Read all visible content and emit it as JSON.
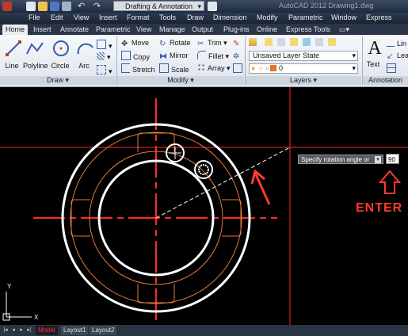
{
  "app": {
    "workspace": "Drafting & Annotation",
    "title": "AutoCAD 2012  Drawing1.dwg"
  },
  "menu": [
    "File",
    "Edit",
    "View",
    "Insert",
    "Format",
    "Tools",
    "Draw",
    "Dimension",
    "Modify",
    "Parametric",
    "Window",
    "Express"
  ],
  "tabs": [
    "Home",
    "Insert",
    "Annotate",
    "Parametric",
    "View",
    "Manage",
    "Output",
    "Plug-ins",
    "Online",
    "Express Tools"
  ],
  "ribbon": {
    "draw": {
      "title": "Draw",
      "line": "Line",
      "polyline": "Polyline",
      "circle": "Circle",
      "arc": "Arc"
    },
    "modify": {
      "title": "Modify",
      "move": "Move",
      "rotate": "Rotate",
      "trim": "Trim",
      "copy": "Copy",
      "mirror": "Mirror",
      "fillet": "Fillet",
      "stretch": "Stretch",
      "scale": "Scale",
      "array": "Array"
    },
    "layers": {
      "title": "Layers",
      "layer_state": "Unsaved Layer State",
      "current_layer": "0"
    },
    "annotation": {
      "title": "Annotation",
      "text": "Text",
      "linear": "Lin",
      "leader": "Lea"
    }
  },
  "command": {
    "prompt": "Specify rotation angle or",
    "value": "90"
  },
  "callout": {
    "text": "ENTER"
  },
  "layout_tabs": [
    "Model",
    "Layout1",
    "Layout2"
  ],
  "colors": {
    "accent": "#ff3b30",
    "crosshair": "#ff2a2a",
    "geometry": "#ffffff",
    "hidden": "#e07a3a"
  }
}
